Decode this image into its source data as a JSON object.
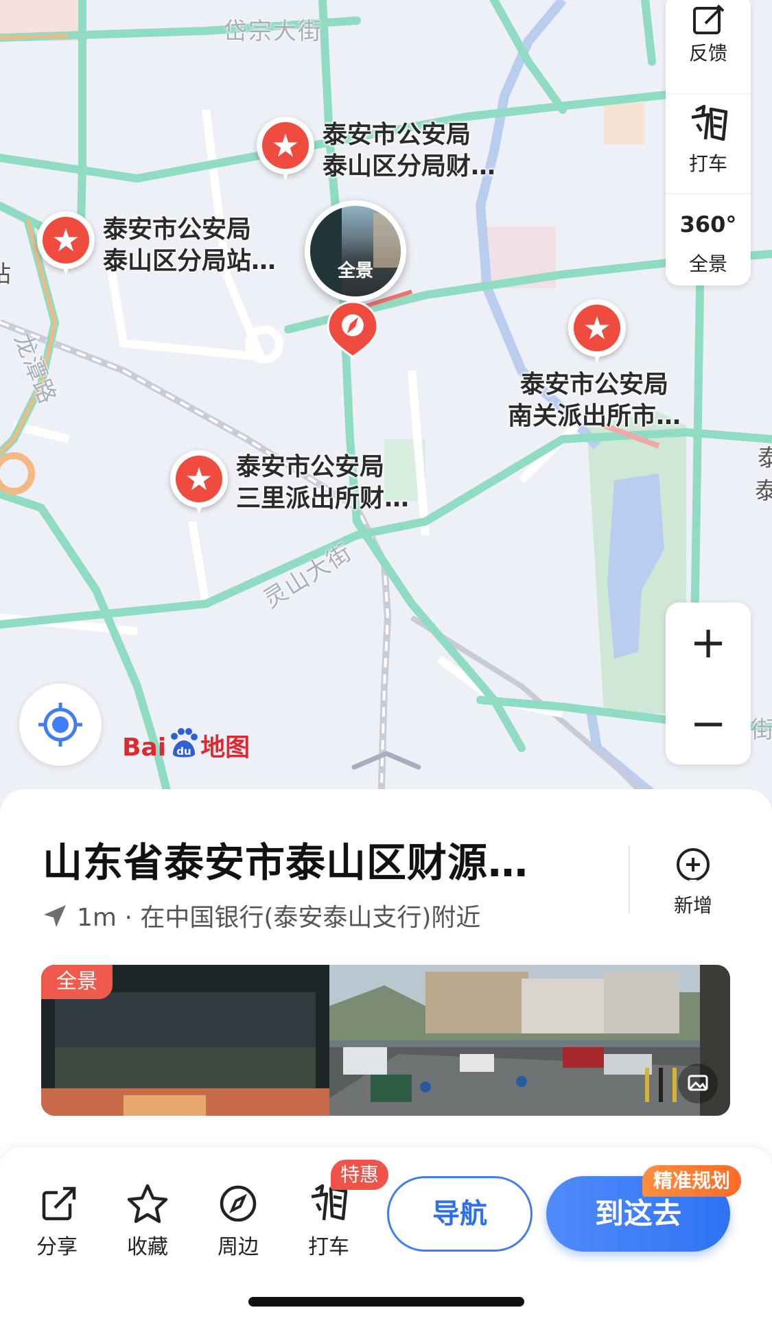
{
  "map": {
    "road_labels": [
      "岱宗大街",
      "龙潭路",
      "灵山大街"
    ],
    "pois": [
      {
        "line1": "泰安市公安局",
        "line2": "泰山区分局财…"
      },
      {
        "line1": "泰安市公安局",
        "line2": "泰山区分局站…"
      },
      {
        "line1": "泰安市公安局",
        "line2": "南关派出所市…"
      },
      {
        "line1": "泰安市公安局",
        "line2": "三里派出所财…"
      }
    ],
    "pano_bubble_label": "全景",
    "edge_fragments": [
      "站",
      "泰",
      "泰",
      "街"
    ],
    "brand": {
      "prefix": "Bai",
      "suffix": "地图"
    },
    "colors": {
      "road": "#8fdcc3",
      "arterial": "#7fd6b9",
      "water": "#b9cdef",
      "park": "#cfe8d6",
      "poi_red": "#ef4b3f"
    }
  },
  "side_panel": {
    "feedback": {
      "label": "反馈",
      "icon": "edit-square-icon"
    },
    "taxi": {
      "label": "打车",
      "icon": "taxi-icon"
    },
    "panorama": {
      "label": "全景",
      "icon": "360-icon",
      "icon_text": "360°"
    }
  },
  "zoom": {
    "in": "+",
    "out": "−"
  },
  "place": {
    "title": "山东省泰安市泰山区财源…",
    "distance": "1m",
    "separator": "·",
    "nearby": "在中国银行(泰安泰山支行)附近",
    "add_label": "新增"
  },
  "pano_card": {
    "tag": "全景"
  },
  "actions": {
    "share": "分享",
    "favorite": "收藏",
    "nearby": "周边",
    "taxi": "打车",
    "taxi_badge": "特惠",
    "navigate": "导航",
    "go_here": "到这去",
    "go_badge": "精准规划"
  },
  "accent": "#3f7cf6"
}
